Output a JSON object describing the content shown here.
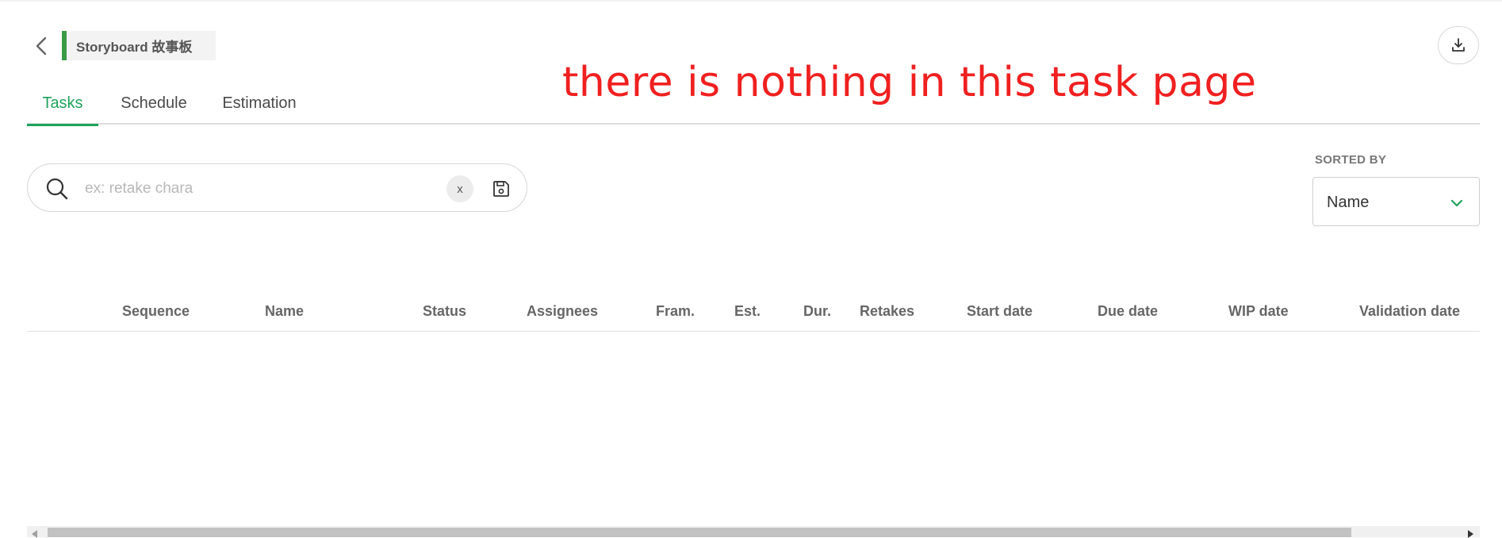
{
  "header": {
    "task_type": "Storyboard 故事板",
    "back_icon": "chevron-left-icon",
    "download_icon": "download-icon"
  },
  "annotation": "there is nothing in this task page",
  "tabs": [
    {
      "label": "Tasks",
      "active": true
    },
    {
      "label": "Schedule",
      "active": false
    },
    {
      "label": "Estimation",
      "active": false
    }
  ],
  "search": {
    "placeholder": "ex: retake chara",
    "value": "",
    "clear_label": "x",
    "icon": "search-icon",
    "save_icon": "save-icon"
  },
  "sort": {
    "label": "SORTED BY",
    "value": "Name",
    "icon": "chevron-down-icon"
  },
  "table": {
    "columns": [
      "Sequence",
      "Name",
      "Status",
      "Assignees",
      "Fram.",
      "Est.",
      "Dur.",
      "Retakes",
      "Start date",
      "Due date",
      "WIP date",
      "Validation date"
    ],
    "rows": []
  },
  "colors": {
    "accent": "#1fa35b",
    "task_type_bar": "#3a9a45",
    "annotation": "#f02020"
  }
}
